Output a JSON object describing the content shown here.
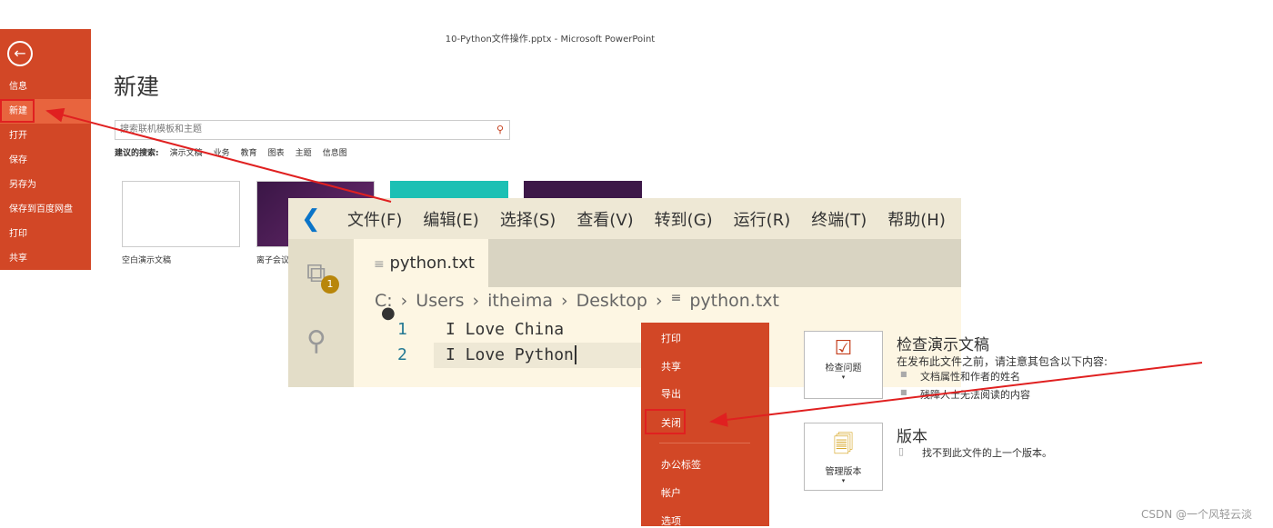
{
  "window_title": "10-Python文件操作.pptx - Microsoft PowerPoint",
  "ppt_sidebar": {
    "back_icon": "arrow-left-circle-icon",
    "items": [
      "信息",
      "新建",
      "打开",
      "保存",
      "另存为",
      "保存到百度网盘",
      "打印",
      "共享"
    ],
    "selected": "新建"
  },
  "new_page": {
    "heading": "新建",
    "search_placeholder": "搜索联机模板和主题",
    "suggest_label": "建议的搜索:",
    "suggestions": [
      "演示文稿",
      "业务",
      "教育",
      "图表",
      "主题",
      "信息图"
    ],
    "templates": [
      "空白演示文稿",
      "离子会议"
    ]
  },
  "vscode": {
    "menu": [
      "文件(F)",
      "编辑(E)",
      "选择(S)",
      "查看(V)",
      "转到(G)",
      "运行(R)",
      "终端(T)",
      "帮助(H)"
    ],
    "badge": "1",
    "tab": "python.txt",
    "breadcrumb": [
      "C:",
      "Users",
      "itheima",
      "Desktop",
      "python.txt"
    ],
    "lines": [
      {
        "n": "1",
        "text": "I Love China"
      },
      {
        "n": "2",
        "text": "I Love Python"
      }
    ]
  },
  "ppt_menu2": {
    "items": [
      "打印",
      "共享",
      "导出",
      "关闭",
      "办公标签",
      "帐户",
      "选项"
    ],
    "highlighted": "关闭"
  },
  "info": {
    "inspect_button": "检查问题",
    "inspect_title": "检查演示文稿",
    "inspect_desc": "在发布此文件之前，请注意其包含以下内容:",
    "inspect_items": [
      "文档属性和作者的姓名",
      "残障人士无法阅读的内容"
    ],
    "version_button": "管理版本",
    "version_title": "版本",
    "version_desc": "找不到此文件的上一个版本。"
  },
  "watermark": "CSDN @一个风轻云淡",
  "colors": {
    "ppt_orange": "#d24726",
    "annotation_red": "#e02020",
    "vscode_blue": "#0a74c8"
  }
}
